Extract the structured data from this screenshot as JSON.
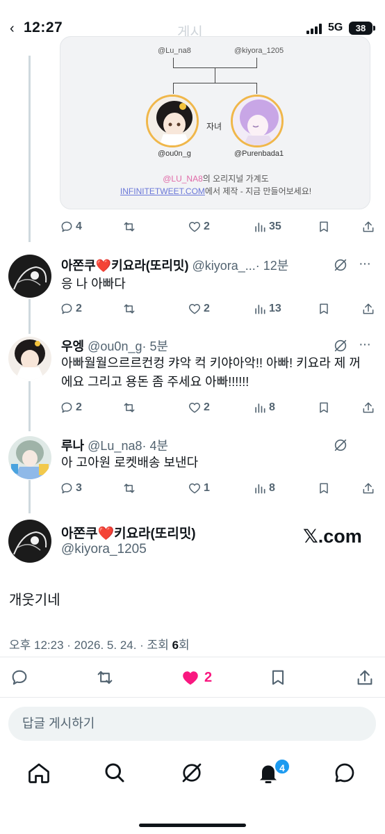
{
  "status_bar": {
    "time": "12:27",
    "network": "5G",
    "battery": "38"
  },
  "header": {
    "title": "게시"
  },
  "family_tree": {
    "parent_left": "@Lu_na8",
    "parent_right": "@kiyora_1205",
    "children_label": "자녀",
    "child_left": "@ou0n_g",
    "child_right": "@Purenbada1",
    "caption_handle": "@LU_NA8",
    "caption_rest": "의 오리지널 가계도",
    "caption_link": "INFINITETWEET.COM",
    "caption_cta": "에서 제작 - 지금 만들어보세요!"
  },
  "parent_actions": {
    "replies": "4",
    "reposts": "",
    "likes": "2",
    "views": "35"
  },
  "replies": [
    {
      "name": "아쫀쿠❤️키요라(또리밋)",
      "handle": "@kiyora_...",
      "time": "· 12분",
      "text": "응 나 아빠다",
      "replies": "2",
      "likes": "2",
      "views": "13"
    },
    {
      "name": "우엥",
      "handle": "@ou0n_g",
      "time": "· 5분",
      "text": "아빠월월으르르컨컹 캬악 컥 키야아악!! 아빠! 키요라 제 꺼에요 그리고 용돈 좀 주세요 아빠!!!!!!",
      "replies": "2",
      "likes": "2",
      "views": "8"
    },
    {
      "name": "루나",
      "handle": "@Lu_na8",
      "time": "· 4분",
      "text": "아 고아원 로켓배송 보낸다",
      "replies": "3",
      "likes": "1",
      "views": "8"
    }
  ],
  "main_tweet": {
    "name": "아쫀쿠❤️키요라(또리밋)",
    "handle": "@kiyora_1205",
    "badge": "𝕏.com",
    "text": "개웃기네",
    "meta_time": "오후 12:23 · 2026. 5. 24. · 조회 ",
    "meta_views": "6",
    "meta_suffix": "회",
    "likes": "2"
  },
  "reply_box": {
    "placeholder": "답글 게시하기"
  },
  "nav": {
    "notification_count": "4"
  },
  "colors": {
    "like_pink": "#f91880",
    "accent_blue": "#1d9bf0",
    "muted": "#536471"
  }
}
